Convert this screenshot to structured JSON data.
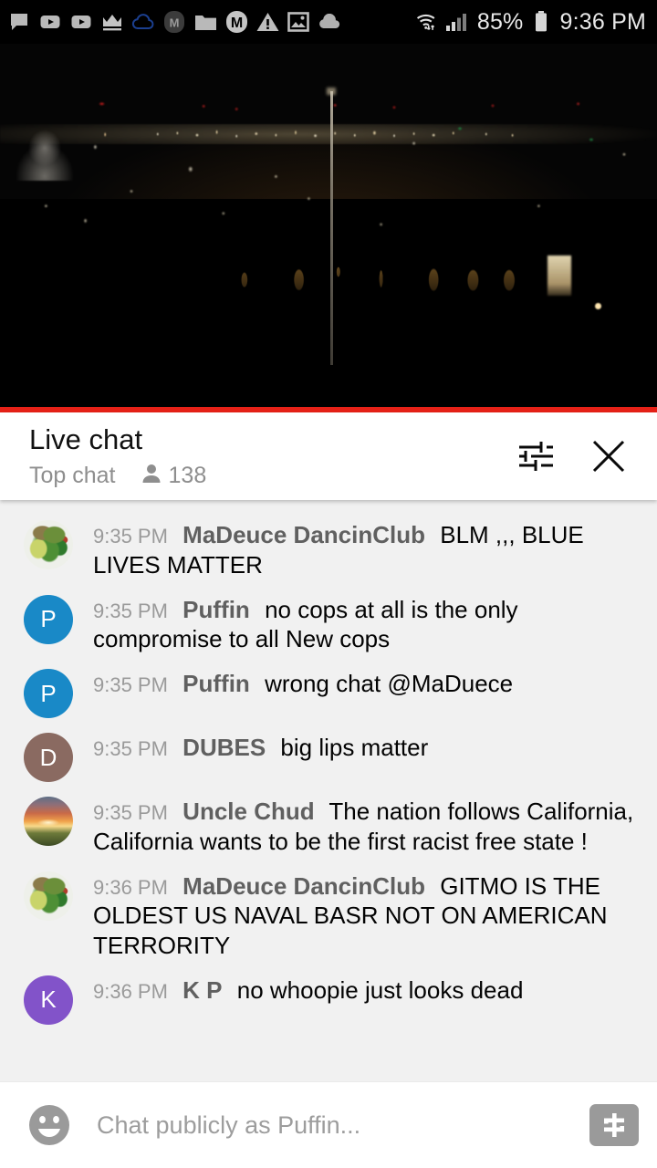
{
  "statusbar": {
    "left_icons": [
      "message-bubble-icon",
      "youtube-play-icon",
      "youtube-play-icon",
      "crown-icon",
      "cloud-outline-icon",
      "m-badge-icon",
      "folder-icon",
      "m-circle-icon",
      "warning-triangle-icon",
      "image-icon",
      "cloud-filled-icon"
    ],
    "wifi_icon": "wifi-transfer-icon",
    "signal_icon": "cellular-signal-icon",
    "battery_percent": "85%",
    "battery_icon": "battery-icon",
    "clock": "9:36 PM"
  },
  "video": {
    "description": "night-cityscape-live-stream",
    "progress_color": "#e62117",
    "progress_percent": 100
  },
  "chat_header": {
    "title": "Live chat",
    "mode": "Top chat",
    "viewer_icon": "person-icon",
    "viewer_count": "138",
    "settings_icon": "tune-sliders-icon",
    "close_icon": "close-x-icon"
  },
  "messages": [
    {
      "avatar_type": "image",
      "avatar_class": "img-dragon",
      "avatar_letter": "",
      "avatar_color": "#eef0ea",
      "time": "9:35 PM",
      "author": "MaDeuce DancinClub",
      "text": "BLM ,,, BLUE LIVES MATTER"
    },
    {
      "avatar_type": "letter",
      "avatar_class": "",
      "avatar_letter": "P",
      "avatar_color": "#1989c7",
      "time": "9:35 PM",
      "author": "Puffin",
      "text": "no cops at all is the only compromise to all New cops"
    },
    {
      "avatar_type": "letter",
      "avatar_class": "",
      "avatar_letter": "P",
      "avatar_color": "#1989c7",
      "time": "9:35 PM",
      "author": "Puffin",
      "text": "wrong chat @MaDuece"
    },
    {
      "avatar_type": "letter",
      "avatar_class": "",
      "avatar_letter": "D",
      "avatar_color": "#8a6a61",
      "time": "9:35 PM",
      "author": "DUBES",
      "text": "big lips matter"
    },
    {
      "avatar_type": "image",
      "avatar_class": "img-sunset",
      "avatar_letter": "",
      "avatar_color": "#c96a48",
      "time": "9:35 PM",
      "author": "Uncle Chud",
      "text": "The nation follows California, California wants to be the first racist free state !"
    },
    {
      "avatar_type": "image",
      "avatar_class": "img-dragon",
      "avatar_letter": "",
      "avatar_color": "#eef0ea",
      "time": "9:36 PM",
      "author": "MaDeuce DancinClub",
      "text": "GITMO IS THE OLDEST US NAVAL BASR NOT ON AMERICAN TERRORITY"
    },
    {
      "avatar_type": "letter",
      "avatar_class": "",
      "avatar_letter": "K",
      "avatar_color": "#8253c9",
      "time": "9:36 PM",
      "author": "K P",
      "text": "no whoopie just looks dead"
    }
  ],
  "chat_input": {
    "emoji_icon": "emoji-smiley-icon",
    "placeholder": "Chat publicly as Puffin...",
    "superchat_icon": "dollar-superchat-icon"
  }
}
